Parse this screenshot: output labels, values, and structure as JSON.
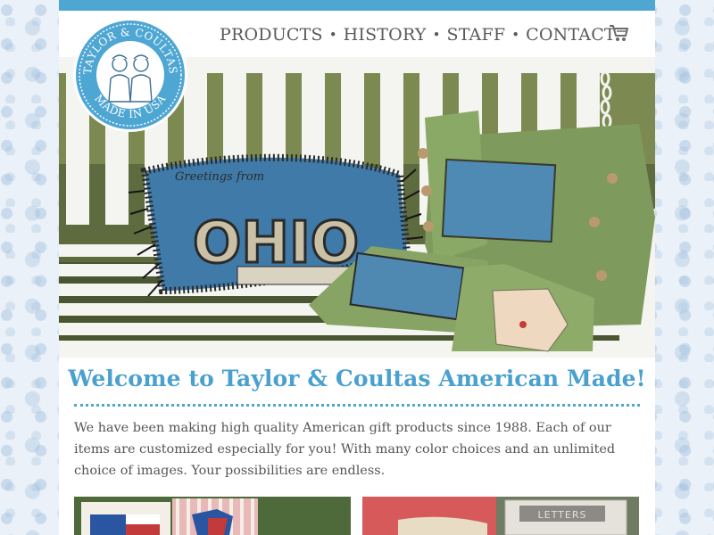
{
  "brand": {
    "logo_top_text": "TAYLOR & COULTAS",
    "logo_bottom_text": "MADE IN USA",
    "accent_color": "#4ea6d3"
  },
  "nav": {
    "items": [
      "PRODUCTS",
      "HISTORY",
      "STAFF",
      "CONTACT"
    ],
    "separator": "•",
    "cart_icon": "shopping-cart-icon"
  },
  "hero": {
    "pillow_script_text": "Greetings from",
    "pillow_letters": "OHIO"
  },
  "welcome": {
    "title": "Welcome to Taylor & Coultas American Made!",
    "body": "We have been making high quality American gift products since 1988. Each of our items are customized especially for you! With many color choices and an unlimited choice of images. Your possibilities are endless."
  },
  "thumbnails": {
    "right_sign_text": "LETTERS"
  }
}
